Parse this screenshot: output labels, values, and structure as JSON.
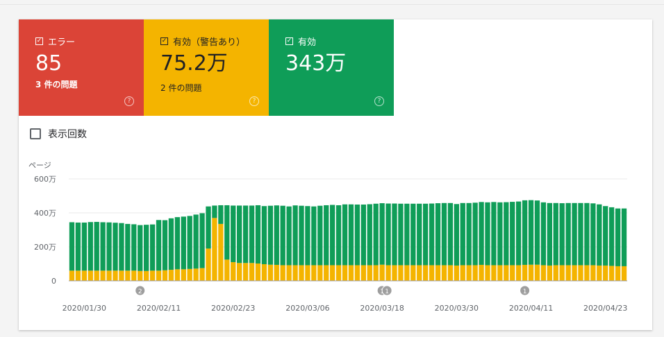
{
  "tiles": [
    {
      "label": "エラー",
      "value": "85",
      "sub": "3 件の問題",
      "color": "#db4437"
    },
    {
      "label": "有効（警告あり）",
      "value": "75.2万",
      "sub": "2 件の問題",
      "color": "#f4b400"
    },
    {
      "label": "有効",
      "value": "343万",
      "sub": "",
      "color": "#0f9d58"
    }
  ],
  "impressions_toggle": {
    "label": "表示回数",
    "checked": false
  },
  "chart_data": {
    "type": "bar",
    "stacked": true,
    "ylabel": "ページ",
    "yticks": [
      "0",
      "200万",
      "400万",
      "600万"
    ],
    "ylim": [
      0,
      600
    ],
    "unit": "万",
    "x_tick_labels": [
      "2020/01/30",
      "2020/02/11",
      "2020/02/23",
      "2020/03/06",
      "2020/03/18",
      "2020/03/30",
      "2020/04/11",
      "2020/04/23"
    ],
    "x": [
      "2020/01/28",
      "2020/01/29",
      "2020/01/30",
      "2020/01/31",
      "2020/02/01",
      "2020/02/02",
      "2020/02/03",
      "2020/02/04",
      "2020/02/05",
      "2020/02/06",
      "2020/02/07",
      "2020/02/08",
      "2020/02/09",
      "2020/02/10",
      "2020/02/11",
      "2020/02/12",
      "2020/02/13",
      "2020/02/14",
      "2020/02/15",
      "2020/02/16",
      "2020/02/17",
      "2020/02/18",
      "2020/02/19",
      "2020/02/20",
      "2020/02/21",
      "2020/02/22",
      "2020/02/23",
      "2020/02/24",
      "2020/02/25",
      "2020/02/26",
      "2020/02/27",
      "2020/02/28",
      "2020/02/29",
      "2020/03/01",
      "2020/03/02",
      "2020/03/03",
      "2020/03/04",
      "2020/03/05",
      "2020/03/06",
      "2020/03/07",
      "2020/03/08",
      "2020/03/09",
      "2020/03/10",
      "2020/03/11",
      "2020/03/12",
      "2020/03/13",
      "2020/03/14",
      "2020/03/15",
      "2020/03/16",
      "2020/03/17",
      "2020/03/18",
      "2020/03/19",
      "2020/03/20",
      "2020/03/21",
      "2020/03/22",
      "2020/03/23",
      "2020/03/24",
      "2020/03/25",
      "2020/03/26",
      "2020/03/27",
      "2020/03/28",
      "2020/03/29",
      "2020/03/30",
      "2020/03/31",
      "2020/04/01",
      "2020/04/02",
      "2020/04/03",
      "2020/04/04",
      "2020/04/05",
      "2020/04/06",
      "2020/04/07",
      "2020/04/08",
      "2020/04/09",
      "2020/04/10",
      "2020/04/11",
      "2020/04/12",
      "2020/04/13",
      "2020/04/14",
      "2020/04/15",
      "2020/04/16",
      "2020/04/17",
      "2020/04/18",
      "2020/04/19",
      "2020/04/20",
      "2020/04/21",
      "2020/04/22",
      "2020/04/23",
      "2020/04/24",
      "2020/04/25",
      "2020/04/26"
    ],
    "series": [
      {
        "name": "有効（警告あり）",
        "color": "#f4b400",
        "values": [
          60,
          60,
          60,
          60,
          60,
          60,
          60,
          60,
          60,
          60,
          60,
          58,
          58,
          60,
          60,
          62,
          65,
          68,
          68,
          70,
          72,
          75,
          190,
          370,
          335,
          125,
          110,
          105,
          105,
          105,
          102,
          98,
          95,
          94,
          92,
          92,
          92,
          92,
          92,
          92,
          92,
          92,
          92,
          92,
          92,
          92,
          92,
          92,
          92,
          92,
          95,
          92,
          92,
          92,
          92,
          92,
          92,
          92,
          92,
          92,
          92,
          92,
          90,
          92,
          92,
          92,
          94,
          92,
          92,
          92,
          92,
          92,
          92,
          94,
          95,
          95,
          92,
          90,
          92,
          92,
          92,
          92,
          92,
          92,
          92,
          90,
          90,
          88,
          86,
          86
        ]
      },
      {
        "name": "有効",
        "color": "#0f9d58",
        "values": [
          285,
          283,
          283,
          286,
          287,
          285,
          284,
          282,
          280,
          275,
          273,
          270,
          272,
          272,
          298,
          295,
          303,
          307,
          310,
          312,
          318,
          323,
          248,
          73,
          110,
          320,
          333,
          338,
          338,
          338,
          343,
          342,
          347,
          350,
          350,
          346,
          352,
          350,
          348,
          346,
          350,
          353,
          355,
          353,
          358,
          358,
          357,
          357,
          359,
          362,
          362,
          363,
          363,
          362,
          362,
          362,
          362,
          362,
          363,
          365,
          366,
          366,
          362,
          366,
          366,
          368,
          370,
          370,
          372,
          370,
          371,
          373,
          375,
          380,
          380,
          378,
          370,
          368,
          366,
          365,
          366,
          366,
          366,
          366,
          364,
          360,
          350,
          345,
          340,
          340
        ]
      }
    ],
    "annotations": [
      {
        "x": "2020/02/08",
        "label": "2"
      },
      {
        "x": "2020/03/18",
        "label": "1"
      },
      {
        "x": "2020/03/18",
        "label": "1"
      },
      {
        "x": "2020/04/10",
        "label": "1"
      }
    ],
    "grid": true
  }
}
